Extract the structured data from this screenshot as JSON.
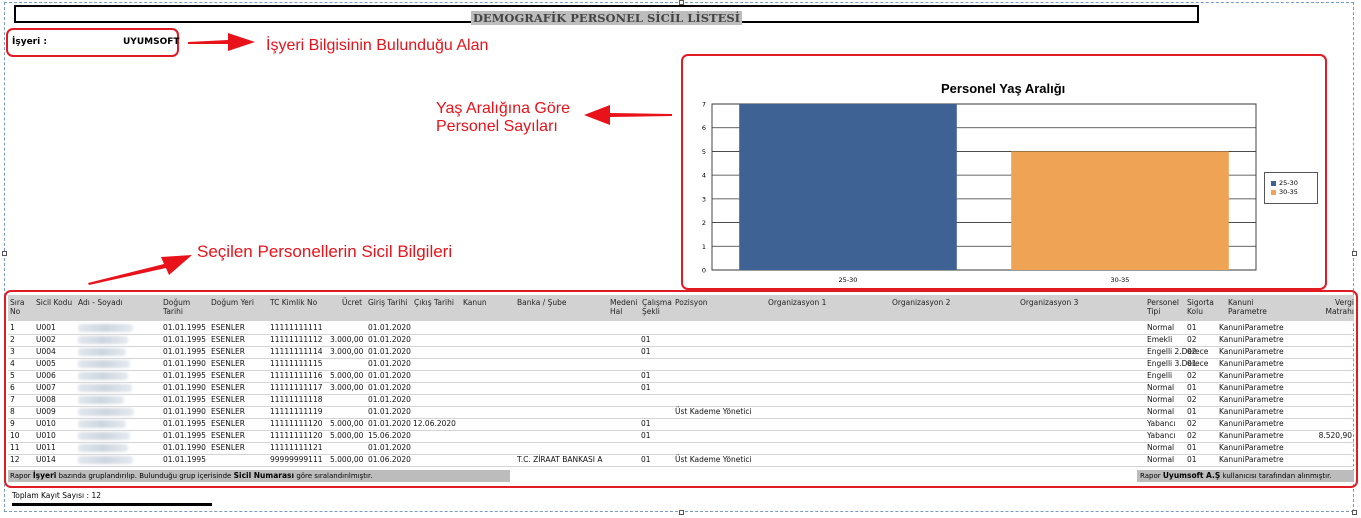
{
  "report": {
    "title": "DEMOGRAFİK PERSONEL SİCİL LİSTESİ",
    "employer_label": "İşyeri :",
    "employer_value": "UYUMSOFT"
  },
  "annotations": {
    "employer_note": "İşyeri Bilgisinin Bulunduğu Alan",
    "age_note_line1": "Yaş Aralığına Göre",
    "age_note_line2": "Personel Sayıları",
    "records_note": "Seçilen Personellerin Sicil Bilgileri",
    "color": "#e8121a"
  },
  "chart_data": {
    "type": "bar",
    "title": "Personel Yaş Aralığı",
    "categories": [
      "25-30",
      "30-35"
    ],
    "values": [
      7,
      5
    ],
    "colors": [
      "#3d6293",
      "#efa455"
    ],
    "legend": [
      "25-30",
      "30-35"
    ],
    "legend_position": "right",
    "ylim": [
      0,
      7
    ],
    "yticks": [
      "0",
      "1",
      "2",
      "3",
      "4",
      "5",
      "6",
      "7"
    ],
    "grid": true
  },
  "table": {
    "headers": {
      "sira_no": [
        "Sıra",
        "No"
      ],
      "sicil_kodu": "Sicil Kodu",
      "adi_soyadi": "Adı - Soyadı",
      "dogum_tarihi": [
        "Doğum",
        "Tarihi"
      ],
      "dogum_yeri": "Doğum Yeri",
      "tc_kimlik_no": "TC Kimlik No",
      "ucret": "Ücret",
      "giris_tarihi": "Giriş Tarihi",
      "cikis_tarihi": "Çıkış Tarihi",
      "kanun": "Kanun",
      "banka_sube": "Banka / Şube",
      "medeni_hal": [
        "Medeni",
        "Hal"
      ],
      "calisma_sekli": [
        "Çalışma",
        "Şekli"
      ],
      "pozisyon": "Pozisyon",
      "organizasyon_1": "Organizasyon 1",
      "organizasyon_2": "Organizasyon 2",
      "organizasyon_3": "Organizasyon 3",
      "personel_tipi": [
        "Personel",
        "Tipi"
      ],
      "sigorta_kolu": [
        "Sigorta",
        "Kolu"
      ],
      "kanuni_parametre": [
        "Kanuni",
        "Parametre"
      ],
      "vergi_matrahi": [
        "Vergi",
        "Matrahı"
      ]
    },
    "rows": [
      {
        "no": "1",
        "kod": "U001",
        "dogum": "01.01.1995",
        "yer": "ESENLER",
        "tc": "11111111111",
        "ucret": "",
        "giris": "01.01.2020",
        "cikis": "",
        "banka": "",
        "calisma": "",
        "pozisyon": "",
        "tip": "Normal",
        "kol": "01",
        "kanuni": "KanuniParametre",
        "vergi": ""
      },
      {
        "no": "2",
        "kod": "U002",
        "dogum": "01.01.1995",
        "yer": "ESENLER",
        "tc": "11111111112",
        "ucret": "3.000,00",
        "giris": "01.01.2020",
        "cikis": "",
        "banka": "",
        "calisma": "01",
        "pozisyon": "",
        "tip": "Emekli",
        "kol": "02",
        "kanuni": "KanuniParametre",
        "vergi": ""
      },
      {
        "no": "3",
        "kod": "U004",
        "dogum": "01.01.1995",
        "yer": "ESENLER",
        "tc": "11111111114",
        "ucret": "3.000,00",
        "giris": "01.01.2020",
        "cikis": "",
        "banka": "",
        "calisma": "01",
        "pozisyon": "",
        "tip": "Engelli 2.Derece",
        "kol": "02",
        "kanuni": "KanuniParametre",
        "vergi": ""
      },
      {
        "no": "4",
        "kod": "U005",
        "dogum": "01.01.1990",
        "yer": "ESENLER",
        "tc": "11111111115",
        "ucret": "",
        "giris": "01.01.2020",
        "cikis": "",
        "banka": "",
        "calisma": "",
        "pozisyon": "",
        "tip": "Engelli 3.Derece",
        "kol": "01",
        "kanuni": "KanuniParametre",
        "vergi": ""
      },
      {
        "no": "5",
        "kod": "U006",
        "dogum": "01.01.1995",
        "yer": "ESENLER",
        "tc": "11111111116",
        "ucret": "5.000,00",
        "giris": "01.01.2020",
        "cikis": "",
        "banka": "",
        "calisma": "01",
        "pozisyon": "",
        "tip": "Engelli",
        "kol": "02",
        "kanuni": "KanuniParametre",
        "vergi": ""
      },
      {
        "no": "6",
        "kod": "U007",
        "dogum": "01.01.1990",
        "yer": "ESENLER",
        "tc": "11111111117",
        "ucret": "3.000,00",
        "giris": "01.01.2020",
        "cikis": "",
        "banka": "",
        "calisma": "01",
        "pozisyon": "",
        "tip": "Normal",
        "kol": "01",
        "kanuni": "KanuniParametre",
        "vergi": ""
      },
      {
        "no": "7",
        "kod": "U008",
        "dogum": "01.01.1995",
        "yer": "ESENLER",
        "tc": "11111111118",
        "ucret": "",
        "giris": "01.01.2020",
        "cikis": "",
        "banka": "",
        "calisma": "",
        "pozisyon": "",
        "tip": "Normal",
        "kol": "02",
        "kanuni": "KanuniParametre",
        "vergi": ""
      },
      {
        "no": "8",
        "kod": "U009",
        "dogum": "01.01.1990",
        "yer": "ESENLER",
        "tc": "11111111119",
        "ucret": "",
        "giris": "01.01.2020",
        "cikis": "",
        "banka": "",
        "calisma": "",
        "pozisyon": "Üst Kademe Yönetici",
        "tip": "Normal",
        "kol": "01",
        "kanuni": "KanuniParametre",
        "vergi": ""
      },
      {
        "no": "9",
        "kod": "U010",
        "dogum": "01.01.1995",
        "yer": "ESENLER",
        "tc": "11111111120",
        "ucret": "5.000,00",
        "giris": "01.01.2020",
        "cikis": "12.06.2020",
        "banka": "",
        "calisma": "01",
        "pozisyon": "",
        "tip": "Yabancı",
        "kol": "02",
        "kanuni": "KanuniParametre",
        "vergi": ""
      },
      {
        "no": "10",
        "kod": "U010",
        "dogum": "01.01.1995",
        "yer": "ESENLER",
        "tc": "11111111120",
        "ucret": "5.000,00",
        "giris": "15.06.2020",
        "cikis": "",
        "banka": "",
        "calisma": "01",
        "pozisyon": "",
        "tip": "Yabancı",
        "kol": "02",
        "kanuni": "KanuniParametre",
        "vergi": "8.520,90"
      },
      {
        "no": "11",
        "kod": "U011",
        "dogum": "01.01.1990",
        "yer": "ESENLER",
        "tc": "11111111121",
        "ucret": "",
        "giris": "01.01.2020",
        "cikis": "",
        "banka": "",
        "calisma": "",
        "pozisyon": "",
        "tip": "Normal",
        "kol": "01",
        "kanuni": "KanuniParametre",
        "vergi": ""
      },
      {
        "no": "12",
        "kod": "U014",
        "dogum": "01.01.1995",
        "yer": "",
        "tc": "99999999111",
        "ucret": "5.000,00",
        "giris": "01.06.2020",
        "cikis": "",
        "banka": "T.C. ZİRAAT BANKASI A",
        "calisma": "01",
        "pozisyon": "Üst Kademe Yönetici",
        "tip": "Normal",
        "kol": "01",
        "kanuni": "KanuniParametre",
        "vergi": ""
      }
    ]
  },
  "footer": {
    "left_prefix": "Rapor",
    "left_group": "İşyeri",
    "left_middle": "bazında  gruplandırılıp. Bulunduğu grup içerisinde",
    "left_sort": "Sicil Numarası",
    "left_suffix": "göre sıralandırılmıştır.",
    "right_prefix": "Rapor",
    "right_user": "Uyumsoft  A.Ş",
    "right_suffix": "kullanıcısı tarafından alınmıştır.",
    "total_label": "Toplam Kayıt Sayısı  :",
    "total_value": "12"
  }
}
